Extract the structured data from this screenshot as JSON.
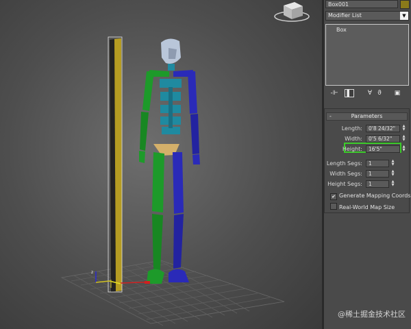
{
  "command_panel": {
    "object_name": "Box001",
    "object_color": "#8a7a1a",
    "modifier_list": {
      "label": "Modifier List",
      "arrow_icon": "chevron-down-icon"
    },
    "stack": {
      "items": [
        "Box"
      ]
    },
    "stack_toolbar": [
      "pin-stack-icon",
      "show-end-result-icon",
      "make-unique-icon",
      "remove-modifier-icon",
      "configure-modifier-sets-icon"
    ],
    "parameters": {
      "title": "Parameters",
      "toggle": "-",
      "length": {
        "label": "Length:",
        "value": "0'8 24/32\""
      },
      "width": {
        "label": "Width:",
        "value": "0'5 6/32\""
      },
      "height": {
        "label": "Height:",
        "value": "16'5\""
      },
      "length_segs": {
        "label": "Length Segs:",
        "value": "1"
      },
      "width_segs": {
        "label": "Width Segs:",
        "value": "1"
      },
      "height_segs": {
        "label": "Height Segs:",
        "value": "1"
      },
      "generate_mapping": {
        "label": "Generate Mapping Coords.",
        "checked": true
      },
      "real_world_map": {
        "label": "Real-World Map Size",
        "checked": false
      },
      "highlight_color": "#3ccc2a"
    }
  },
  "viewport": {
    "view_cube_label": "view-cube-icon",
    "figure_colors": {
      "head": "#b9c6d9",
      "spine": "#1f8aa0",
      "left_side": "#1d9a2a",
      "right_side": "#2a2ab8",
      "pelvis": "#d4b06a",
      "box": "#a89020"
    }
  },
  "watermark": "@稀土掘金技术社区"
}
